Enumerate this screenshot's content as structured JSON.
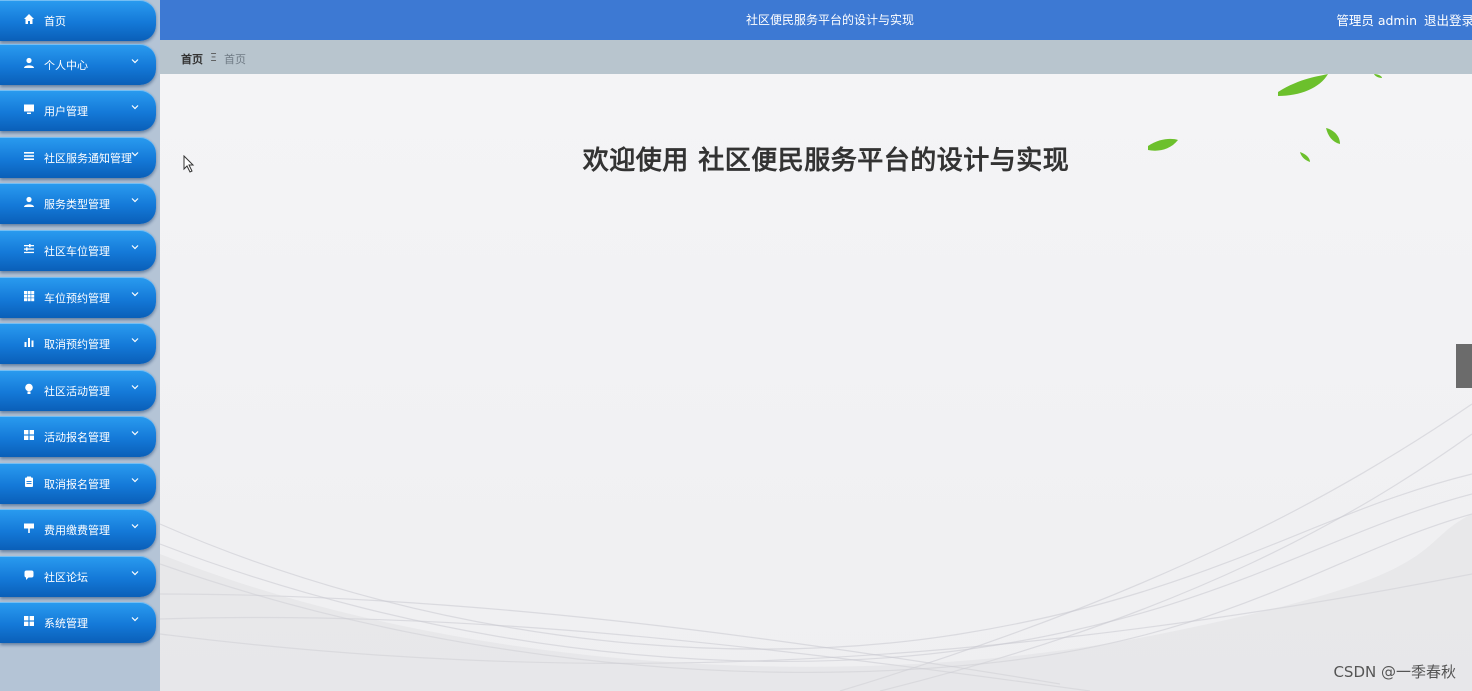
{
  "sidebar": {
    "items": [
      {
        "label": "首页",
        "icon": "home-icon",
        "has_chevron": false
      },
      {
        "label": "个人中心",
        "icon": "user-icon",
        "has_chevron": true
      },
      {
        "label": "用户管理",
        "icon": "monitor-icon",
        "has_chevron": true
      },
      {
        "label": "社区服务通知管理",
        "icon": "list-icon",
        "has_chevron": true
      },
      {
        "label": "服务类型管理",
        "icon": "user-icon",
        "has_chevron": true
      },
      {
        "label": "社区车位管理",
        "icon": "sliders-icon",
        "has_chevron": true
      },
      {
        "label": "车位预约管理",
        "icon": "grid-icon",
        "has_chevron": true
      },
      {
        "label": "取消预约管理",
        "icon": "bar-chart-icon",
        "has_chevron": true
      },
      {
        "label": "社区活动管理",
        "icon": "bulb-icon",
        "has_chevron": true
      },
      {
        "label": "活动报名管理",
        "icon": "apps-icon",
        "has_chevron": true
      },
      {
        "label": "取消报名管理",
        "icon": "clipboard-icon",
        "has_chevron": true
      },
      {
        "label": "费用缴费管理",
        "icon": "sign-icon",
        "has_chevron": true
      },
      {
        "label": "社区论坛",
        "icon": "comment-icon",
        "has_chevron": true
      },
      {
        "label": "系统管理",
        "icon": "apps-icon",
        "has_chevron": true
      }
    ]
  },
  "header": {
    "title": "社区便民服务平台的设计与实现",
    "user": "管理员 admin",
    "logout": "退出登录"
  },
  "breadcrumb": {
    "home": "首页",
    "separator": "Ξ",
    "current": "首页"
  },
  "main": {
    "welcome": "欢迎使用 社区便民服务平台的设计与实现"
  },
  "watermark": "CSDN @一季春秋",
  "colors": {
    "header": "#3d79d3",
    "menu_item": "#1479d8",
    "sidebar_bg": "#b4c4d6",
    "breadcrumb_bg": "#b8c5ce",
    "leaf": "#6cc02c"
  }
}
